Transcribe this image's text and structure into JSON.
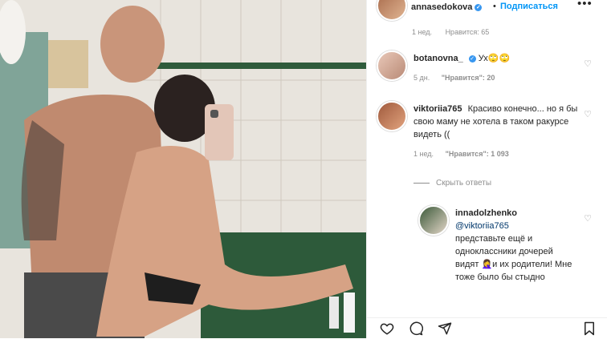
{
  "post": {
    "username": "annasedokova",
    "dot": "•",
    "follow_label": "Подписаться",
    "more_label": "•••"
  },
  "cut_comment": {
    "time": "1 нед.",
    "likes": "Нравится: 65"
  },
  "comments": [
    {
      "username": "botanovna_",
      "text": "Ух🙄🙄",
      "time": "5 дн.",
      "likes": "\"Нравится\": 20"
    },
    {
      "username": "viktoriia765",
      "text": "Красиво конечно... но я бы свою маму не хотела в таком ракурсе видеть ((",
      "time": "1 нед.",
      "likes": "\"Нравится\": 1 093",
      "hide_replies": "Скрыть ответы"
    }
  ],
  "reply": {
    "username": "innadolzhenko",
    "mention": "@viktoriia765",
    "text": "представьте ещё и одноклассники дочерей видят 🤦‍♀️и их родители! Мне тоже было бы стыдно"
  },
  "colors": {
    "link_blue": "#0095f6",
    "verified_blue": "#3897f0",
    "muted": "#8e8e8e"
  },
  "icons": [
    "heart-icon",
    "comment-icon",
    "share-icon",
    "bookmark-icon",
    "more-icon",
    "verified-badge-icon"
  ]
}
